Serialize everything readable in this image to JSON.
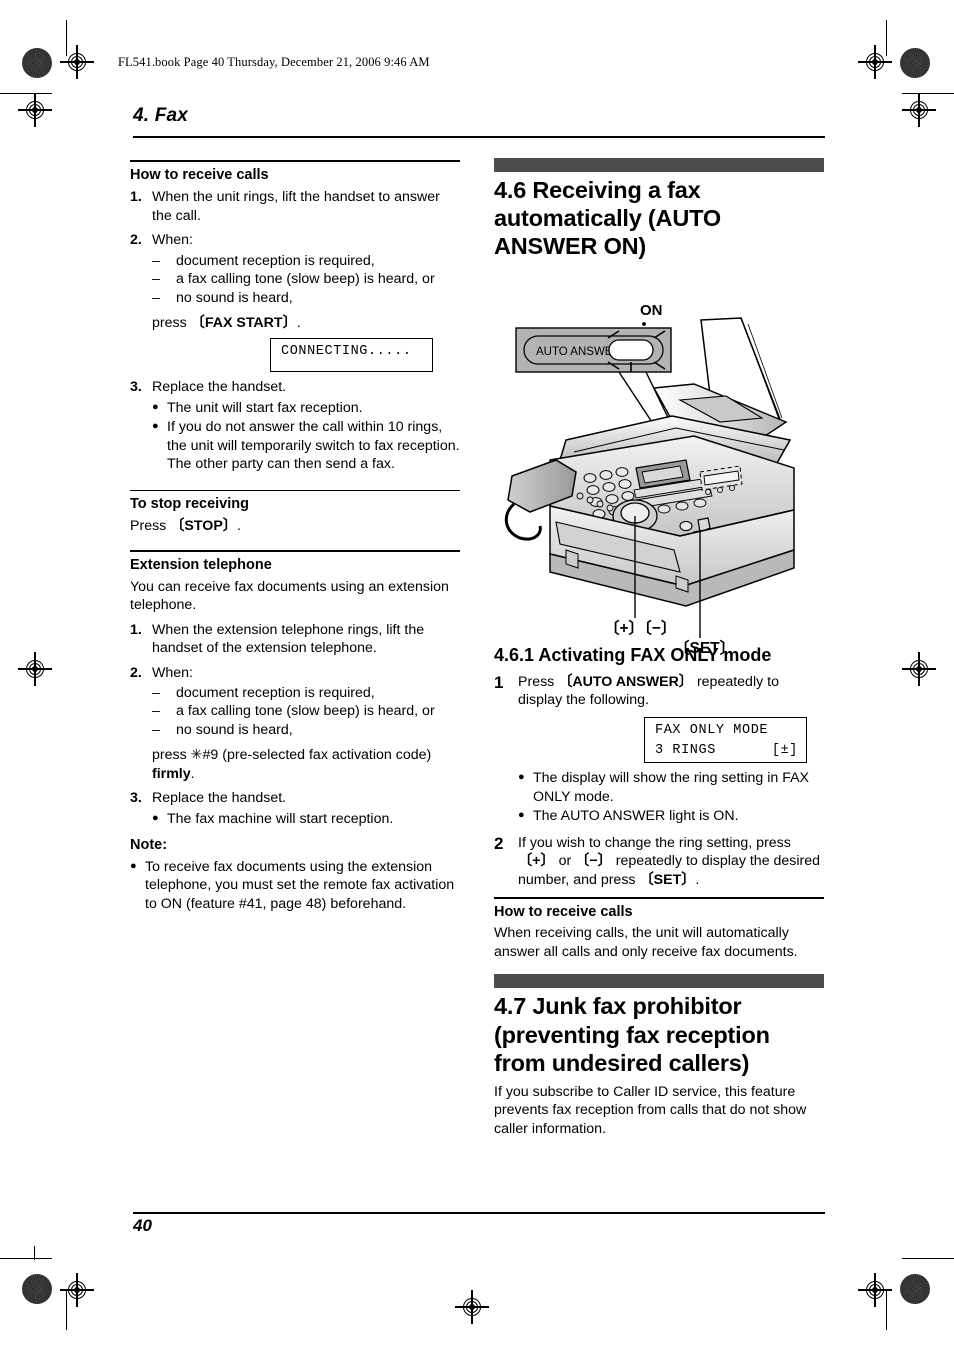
{
  "header": {
    "book_line": "FL541.book  Page 40  Thursday, December 21, 2006  9:46 AM",
    "chapter_title": "4. Fax"
  },
  "footer": {
    "page_number": "40"
  },
  "colors": {
    "section_bar": "#4d4d4d",
    "text": "#000000",
    "page": "#ffffff"
  },
  "left_column": {
    "how_to_receive_calls": {
      "heading": "How to receive calls",
      "steps": [
        {
          "num": "1.",
          "text": "When the unit rings, lift the handset to answer the call."
        },
        {
          "num": "2.",
          "text": "When:"
        },
        {
          "num": "3.",
          "text": "Replace the handset."
        }
      ],
      "step2_dashes": [
        "document reception is required,",
        "a fax calling tone (slow beep) is heard, or",
        "no sound is heard,"
      ],
      "step2_press_prefix": "press ",
      "step2_press_key": "{FAX START}",
      "step2_press_suffix": ".",
      "lcd_connecting": "CONNECTING.....",
      "step3_bullets": [
        "The unit will start fax reception.",
        "If you do not answer the call within 10 rings, the unit will temporarily switch to fax reception. The other party can then send a fax."
      ]
    },
    "to_stop_receiving": {
      "heading": "To stop receiving",
      "text_prefix": "Press ",
      "key": "{STOP}",
      "text_suffix": "."
    },
    "extension_telephone": {
      "heading": "Extension telephone",
      "intro": "You can receive fax documents using an extension telephone.",
      "steps": [
        {
          "num": "1.",
          "text": "When the extension telephone rings, lift the handset of the extension telephone."
        },
        {
          "num": "2.",
          "text": "When:"
        },
        {
          "num": "3.",
          "text": "Replace the handset."
        }
      ],
      "step2_dashes": [
        "document reception is required,",
        "a fax calling tone (slow beep) is heard, or",
        "no sound is heard,"
      ],
      "step2_press_prefix": "press ",
      "step2_press_code": "*#9",
      "step2_press_mid": " (pre-selected fax activation code) ",
      "step2_press_bold": "firmly",
      "step2_press_suffix": ".",
      "step3_bullet": "The fax machine will start reception.",
      "note_heading": "Note:",
      "note_bullet": "To receive fax documents using the extension telephone, you must set the remote fax activation to ON (feature #41, page 48) beforehand."
    }
  },
  "right_column": {
    "section_46": {
      "title": "4.6 Receiving a fax automatically (AUTO ANSWER ON)"
    },
    "illustration": {
      "callout_on": "ON",
      "button_label": "AUTO ANSWER",
      "label_plus_minus": "{+}{−}",
      "label_set": "{SET}"
    },
    "section_461": {
      "title": "4.6.1 Activating FAX ONLY mode",
      "steps": [
        {
          "num": "1",
          "prefix": "Press ",
          "key": "{AUTO ANSWER}",
          "suffix": " repeatedly to display the following."
        },
        {
          "num": "2",
          "text_1": "If you wish to change the ring setting, press ",
          "key_1": "{+}",
          "text_2": " or ",
          "key_2": "{−}",
          "text_3": " repeatedly to display the desired number, and press ",
          "key_3": "{SET}",
          "text_4": "."
        }
      ],
      "lcd_line1": "FAX ONLY MODE",
      "lcd_line2_left": "3 RINGS",
      "lcd_line2_right": "[±]",
      "bullets": [
        "The display will show the ring setting in FAX ONLY mode.",
        "The AUTO ANSWER light is ON."
      ]
    },
    "how_to_receive_calls": {
      "heading": "How to receive calls",
      "text": "When receiving calls, the unit will automatically answer all calls and only receive fax documents."
    },
    "section_47": {
      "title": "4.7 Junk fax prohibitor (preventing fax reception from undesired callers)",
      "body": "If you subscribe to Caller ID service, this feature prevents fax reception from calls that do not show caller information."
    }
  }
}
